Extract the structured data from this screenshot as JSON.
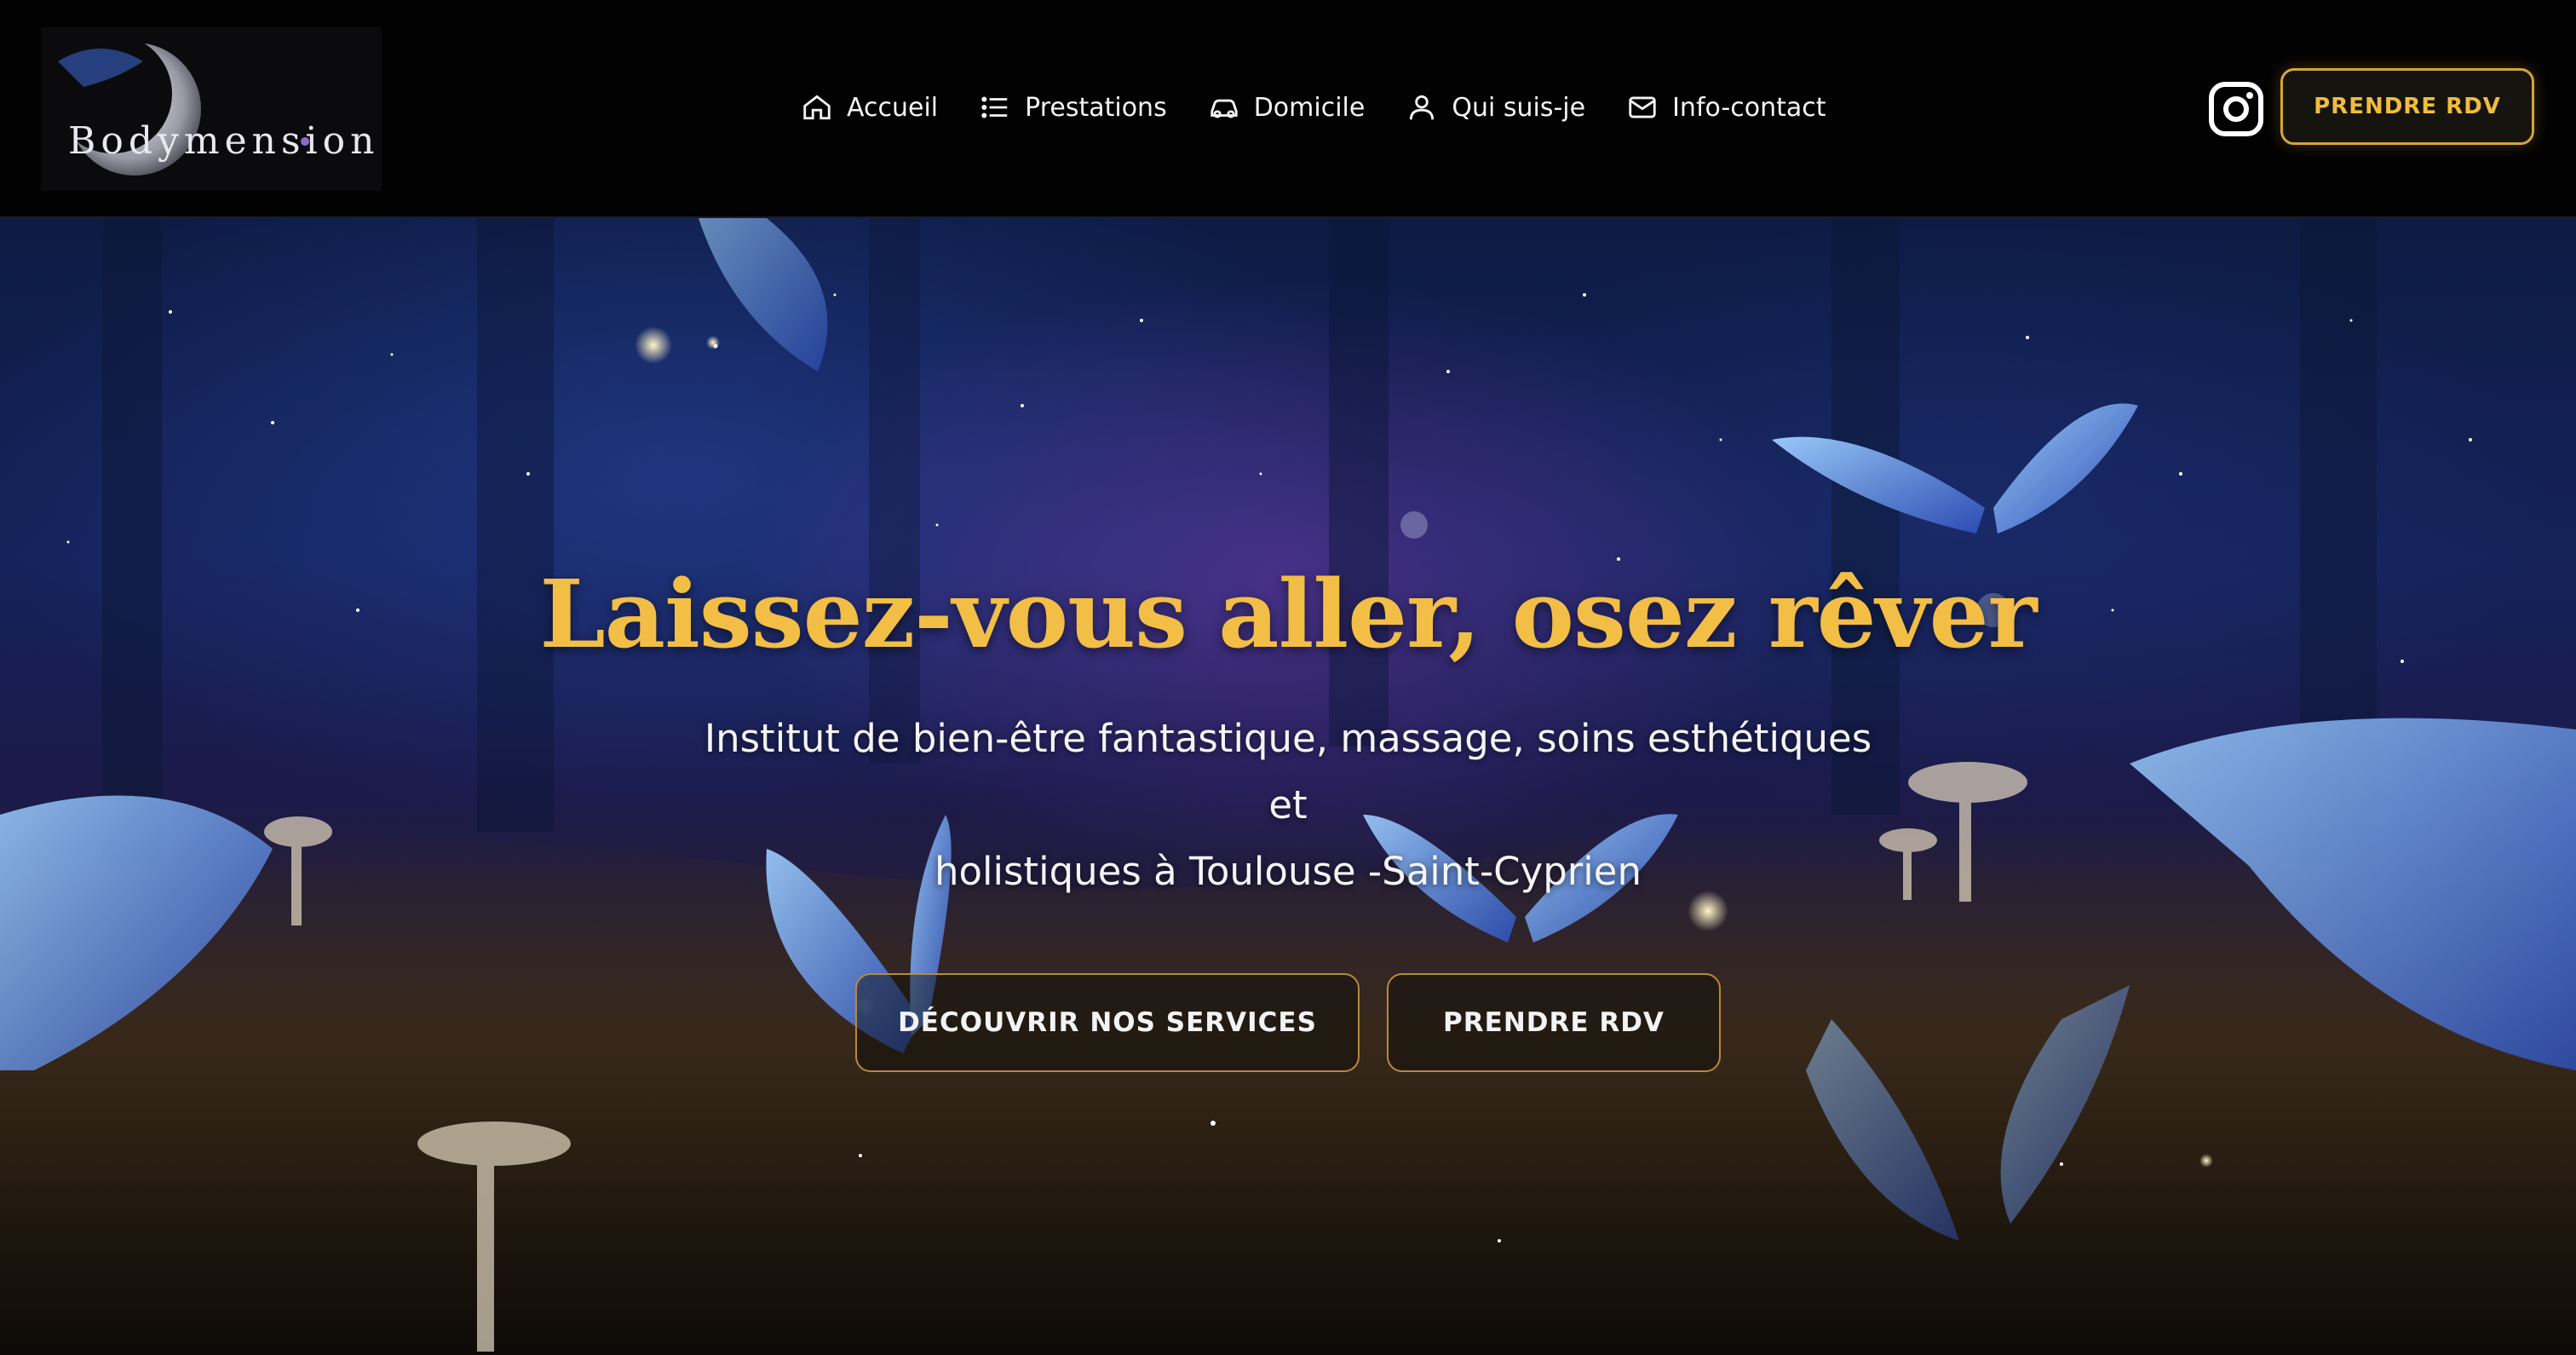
{
  "brand": {
    "logo_text": "Bodymension"
  },
  "nav": {
    "items": [
      {
        "label": "Accueil",
        "icon": "home-icon"
      },
      {
        "label": "Prestations",
        "icon": "list-icon"
      },
      {
        "label": "Domicile",
        "icon": "car-icon"
      },
      {
        "label": "Qui suis-je",
        "icon": "user-icon"
      },
      {
        "label": "Info-contact",
        "icon": "mail-icon"
      }
    ]
  },
  "header": {
    "instagram_icon": "instagram-icon",
    "rdv_label": "PRENDRE RDV"
  },
  "hero": {
    "title": "Laissez-vous aller, osez rêver",
    "subtitle_line1": "Institut de bien-être fantastique, massage, soins esthétiques et",
    "subtitle_line2": "holistiques à Toulouse -Saint-Cyprien",
    "btn_services": "DÉCOUVRIR NOS SERVICES",
    "btn_rdv": "PRENDRE RDV"
  },
  "colors": {
    "accent_gold": "#f2be45",
    "button_border": "#d6a43a",
    "header_bg": "#020202"
  }
}
